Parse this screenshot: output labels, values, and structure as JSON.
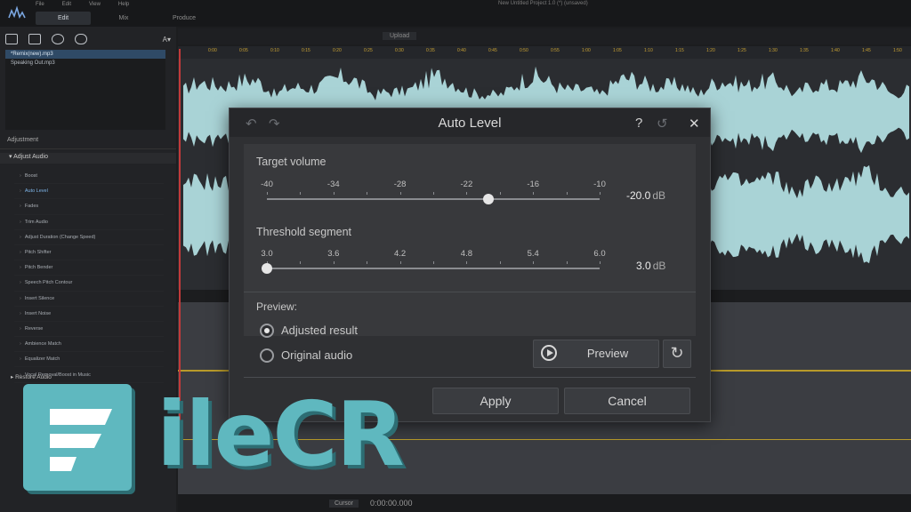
{
  "app": {
    "menu": [
      "File",
      "Edit",
      "View",
      "Help"
    ],
    "modes": [
      "Edit",
      "Mix",
      "Produce"
    ],
    "active_mode": "Edit",
    "project_title": "New Untitled Project 1.0 (*) (unsaved)"
  },
  "left_panel": {
    "files": [
      "*Remix(new).mp3",
      "Speaking Out.mp3"
    ],
    "adjustment_header": "Adjustment",
    "adjust_audio_group": "Adjust Audio",
    "adjust_items": [
      "Boost",
      "Auto Level",
      "Fades",
      "Trim Audio",
      "Adjust Duration (Change Speed)",
      "Pitch Shifter",
      "Pitch Bender",
      "Speech Pitch Contour",
      "Insert Silence",
      "Insert Noise",
      "Reverse",
      "Ambience Match",
      "Equalizer Match",
      "Vocal Removal/Boost in Music"
    ],
    "selected_item": "Auto Level",
    "more_groups": [
      "Restore Audio"
    ]
  },
  "toolbar": {
    "upload_label": "Upload"
  },
  "ruler_labels": [
    "0:00",
    "0:05",
    "0:10",
    "0:15",
    "0:20",
    "0:25",
    "0:30",
    "0:35",
    "0:40",
    "0:45",
    "0:50",
    "0:55",
    "1:00",
    "1:05",
    "1:10",
    "1:15",
    "1:20",
    "1:25",
    "1:30",
    "1:35",
    "1:40",
    "1:45",
    "1:50"
  ],
  "dialog": {
    "title": "Auto Level",
    "target_volume": {
      "label": "Target volume",
      "ticks": [
        "-40",
        "-34",
        "-28",
        "-22",
        "-16",
        "-10"
      ],
      "value": "-20.0",
      "unit": "dB",
      "min": -40,
      "max": -10,
      "current": -20
    },
    "threshold_segment": {
      "label": "Threshold segment",
      "ticks": [
        "3.0",
        "3.6",
        "4.2",
        "4.8",
        "5.4",
        "6.0"
      ],
      "value": "3.0",
      "unit": "dB",
      "min": 3.0,
      "max": 6.0,
      "current": 3.0
    },
    "preview": {
      "label": "Preview:",
      "options": [
        "Adjusted result",
        "Original audio"
      ],
      "selected": "Adjusted result",
      "button_label": "Preview"
    },
    "apply_label": "Apply",
    "cancel_label": "Cancel"
  },
  "transport": {
    "time": "0:00:00.000",
    "chip_label": "Cursor"
  },
  "watermark": "FileCR",
  "colors": {
    "accent": "#5fb8bf",
    "waveform": "#a9d3d6",
    "playhead": "#c23a3a"
  }
}
